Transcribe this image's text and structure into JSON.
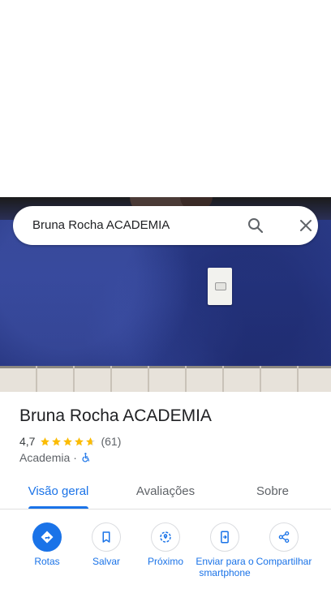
{
  "search": {
    "query": "Bruna Rocha ACADEMIA"
  },
  "place": {
    "name": "Bruna Rocha ACADEMIA",
    "rating": "4,7",
    "stars": 4.7,
    "reviews": "(61)",
    "category": "Academia",
    "separator": "·"
  },
  "tabs": [
    {
      "label": "Visão geral"
    },
    {
      "label": "Avaliações"
    },
    {
      "label": "Sobre"
    }
  ],
  "actions": [
    {
      "label": "Rotas",
      "icon": "directions-icon"
    },
    {
      "label": "Salvar",
      "icon": "bookmark-icon"
    },
    {
      "label": "Próximo",
      "icon": "nearby-icon"
    },
    {
      "label": "Enviar para o smartphone",
      "icon": "send-to-phone-icon"
    },
    {
      "label": "Compartilhar",
      "icon": "share-icon"
    }
  ],
  "colors": {
    "accent": "#1a73e8",
    "star": "#fbbc04",
    "text": "#202124",
    "muted": "#5f6368"
  }
}
